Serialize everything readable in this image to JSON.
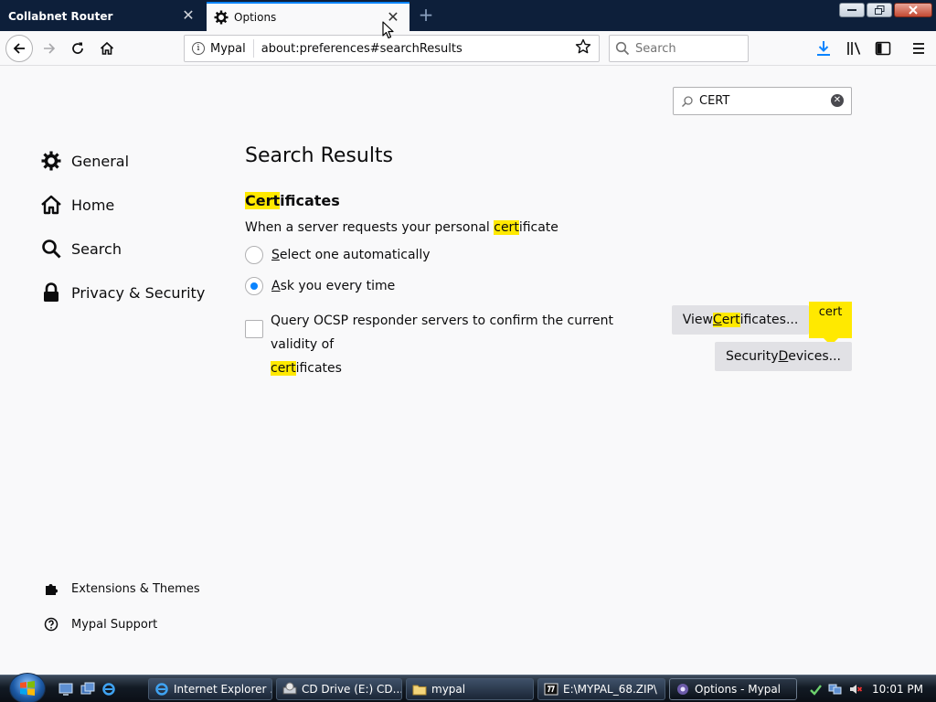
{
  "window": {
    "tabs": [
      {
        "label": "Collabnet Router",
        "active": false
      },
      {
        "label": "Options",
        "active": true
      }
    ]
  },
  "navbar": {
    "identity_label": "Mypal",
    "url": "about:preferences#searchResults",
    "search_placeholder": "Search"
  },
  "find": {
    "value": "CERT"
  },
  "sidebar": {
    "items": [
      {
        "label": "General",
        "icon": "gear-icon"
      },
      {
        "label": "Home",
        "icon": "home-icon"
      },
      {
        "label": "Search",
        "icon": "search-icon"
      },
      {
        "label": "Privacy & Security",
        "icon": "lock-icon"
      }
    ],
    "footer": [
      {
        "label": "Extensions & Themes",
        "icon": "puzzle-icon"
      },
      {
        "label": "Mypal Support",
        "icon": "help-icon"
      }
    ]
  },
  "main": {
    "title": "Search Results",
    "section": {
      "title_hl": "Cert",
      "title_rest": "ificates",
      "desc_pre": "When a server requests your personal ",
      "desc_hl": "cert",
      "desc_post": "ificate",
      "radio_auto_key": "S",
      "radio_auto_rest": "elect one automatically",
      "radio_ask_key": "A",
      "radio_ask_rest": "sk you every time",
      "radio_selected": "ask",
      "ocsp_text": "Query OCSP responder servers to confirm the current validity of",
      "ocsp_hl": "cert",
      "ocsp_rest": "ificates",
      "ocsp_checked": false,
      "view_btn_pre": "View ",
      "view_btn_hl_key": "C",
      "view_btn_hl_rest": "ert",
      "view_btn_post": "ificates...",
      "sec_btn_pre": "Security ",
      "sec_btn_key": "D",
      "sec_btn_post": "evices...",
      "badge": "cert"
    }
  },
  "taskbar": {
    "tasks": [
      {
        "label": "Internet Explorer ...",
        "active": false
      },
      {
        "label": "CD Drive (E:) CD...",
        "active": false
      },
      {
        "label": "mypal",
        "active": false
      },
      {
        "label": "E:\\MYPAL_68.ZIP\\",
        "active": false
      },
      {
        "label": "Options - Mypal",
        "active": true
      }
    ],
    "clock": "10:01 PM"
  },
  "colors": {
    "accent": "#0a84ff",
    "highlight": "#ffe900",
    "tabstrip": "#0d1f3a"
  }
}
